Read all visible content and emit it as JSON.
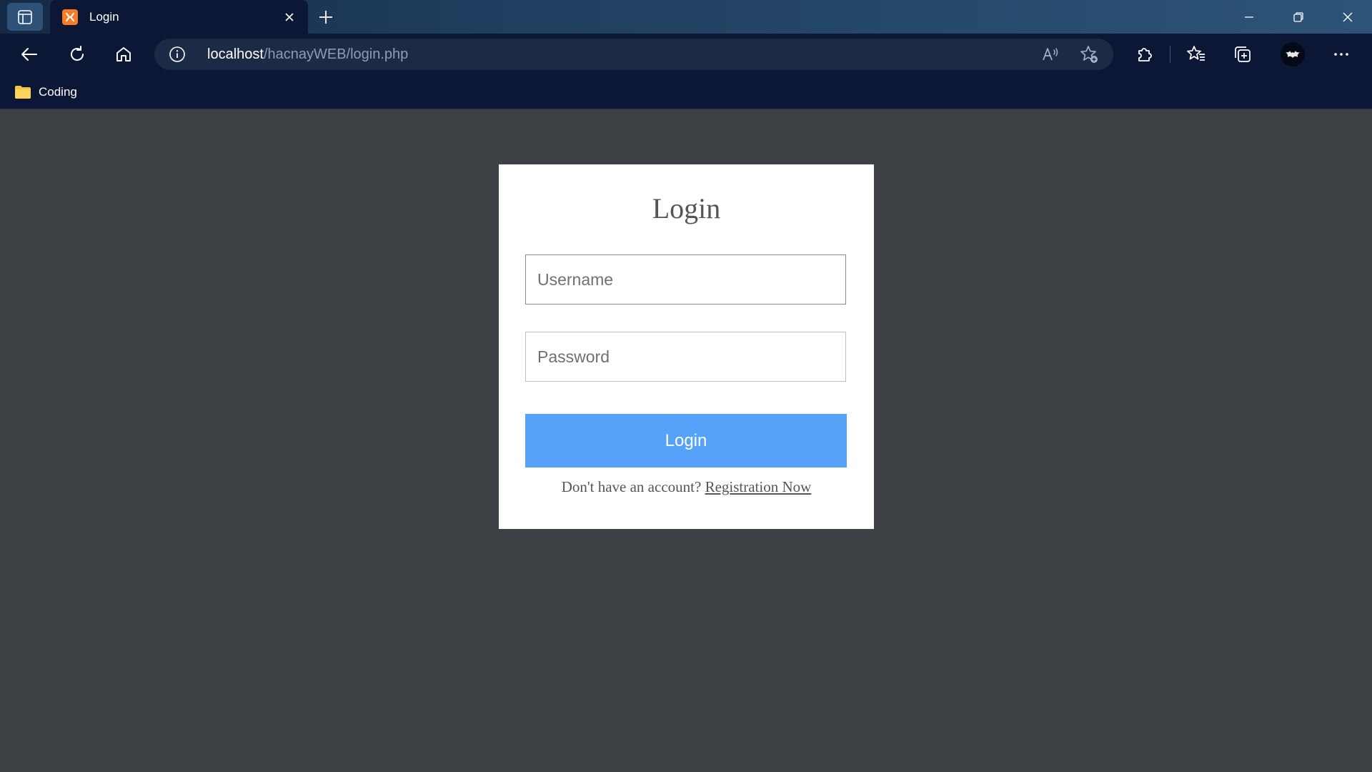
{
  "browser": {
    "tab_title": "Login",
    "url_host": "localhost",
    "url_path": "/hacnayWEB/login.php",
    "favorites": [
      {
        "label": "Coding",
        "icon": "folder-icon"
      }
    ]
  },
  "login_card": {
    "title": "Login",
    "username_placeholder": "Username",
    "password_placeholder": "Password",
    "submit_label": "Login",
    "register_prompt": "Don't have an account?",
    "register_link": "Registration Now"
  },
  "colors": {
    "page_background": "#3d4145",
    "card_background": "#ffffff",
    "button": "#56a2f8",
    "browser_chrome": "#0b1735"
  }
}
